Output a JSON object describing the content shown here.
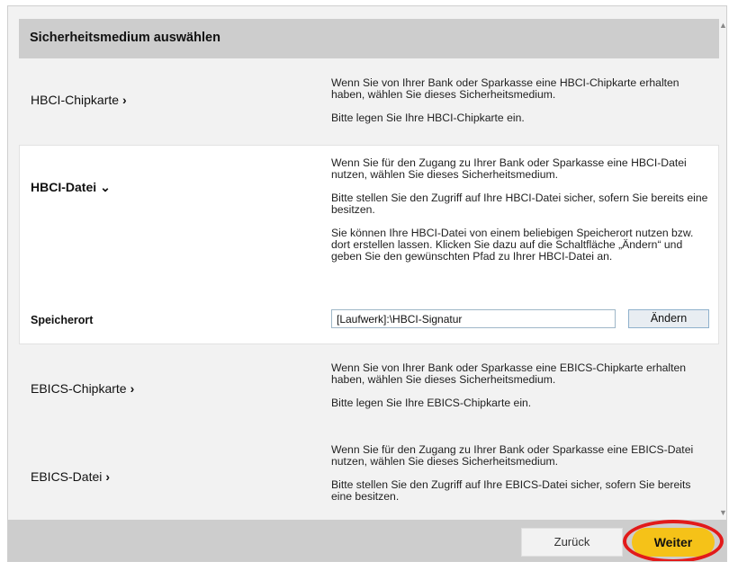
{
  "header": {
    "title": "Sicherheitsmedium auswählen"
  },
  "items": [
    {
      "label": "HBCI-Chipkarte",
      "chevron": "›",
      "desc1": "Wenn Sie von Ihrer Bank oder Sparkasse eine HBCI-Chipkarte erhalten haben, wählen Sie dieses Sicherheitsmedium.",
      "desc2": "Bitte legen Sie Ihre HBCI-Chipkarte ein."
    },
    {
      "label": "HBCI-Datei",
      "chevron": "⌄",
      "desc1": "Wenn Sie für den Zugang zu Ihrer Bank oder Sparkasse eine HBCI-Datei nutzen, wählen Sie dieses Sicherheitsmedium.",
      "desc2": "Bitte stellen Sie den Zugriff auf Ihre HBCI-Datei sicher, sofern Sie bereits eine besitzen.",
      "desc3": "Sie können Ihre HBCI-Datei von einem beliebigen Speicherort nutzen bzw. dort erstellen lassen. Klicken Sie dazu auf die Schaltfläche „Ändern“ und geben Sie den gewünschten Pfad zu Ihrer HBCI-Datei an.",
      "location_label": "Speicherort",
      "location_value": "[Laufwerk]:\\HBCI-Signatur",
      "change_button": "Ändern"
    },
    {
      "label": "EBICS-Chipkarte",
      "chevron": "›",
      "desc1": "Wenn Sie von Ihrer Bank oder Sparkasse eine EBICS-Chipkarte erhalten haben, wählen Sie dieses Sicherheitsmedium.",
      "desc2": "Bitte legen Sie Ihre EBICS-Chipkarte ein."
    },
    {
      "label": "EBICS-Datei",
      "chevron": "›",
      "desc1": "Wenn Sie für den Zugang zu Ihrer Bank oder Sparkasse eine EBICS-Datei nutzen, wählen Sie dieses Sicherheitsmedium.",
      "desc2": "Bitte stellen Sie den Zugriff auf Ihre EBICS-Datei sicher, sofern Sie bereits eine besitzen."
    }
  ],
  "footer": {
    "back_label": "Zurück",
    "next_label": "Weiter"
  },
  "colors": {
    "accent": "#f5c218",
    "highlight": "#e21a1a",
    "header_bg": "#cdcdcd",
    "input_border": "#9fb7c8"
  }
}
